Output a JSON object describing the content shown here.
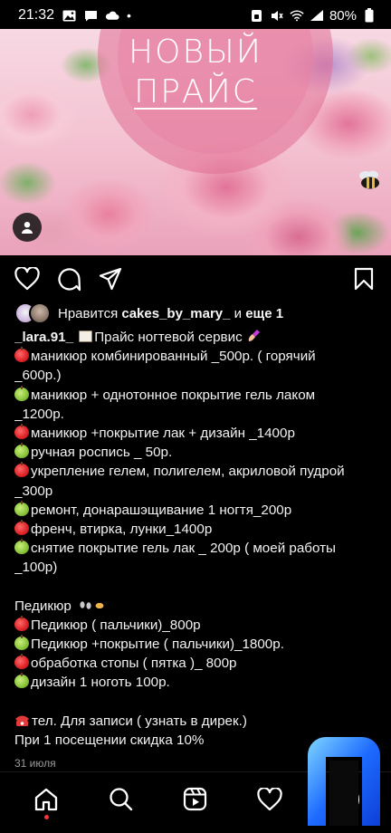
{
  "status_bar": {
    "time": "21:32",
    "battery": "80%",
    "dot": "•"
  },
  "post": {
    "image_title_line1": "НОВЫЙ",
    "image_title_line2": "ПРАЙС",
    "likes": {
      "prefix": "Нравится",
      "user": "cakes_by_mary_",
      "and": "и",
      "more": "еще 1"
    },
    "caption": {
      "username": "_lara.91_",
      "title": "Прайс ногтевой  сервис",
      "lines": [
        {
          "icon": "red-apple-icon",
          "text": "маникюр  комбинированный _500р. ( горячий"
        },
        {
          "icon": "",
          "text": "_600р.)"
        },
        {
          "icon": "green-apple-icon",
          "text": "маникюр + однотонное покрытие гель лаком"
        },
        {
          "icon": "",
          "text": "_1200р."
        },
        {
          "icon": "red-apple-icon",
          "text": "маникюр +покрытие лак + дизайн _1400р"
        },
        {
          "icon": "green-apple-icon",
          "text": "ручная  роспись _ 50р."
        },
        {
          "icon": "red-apple-icon",
          "text": "укрепление гелем,  полигелем, акриловой пудрой"
        },
        {
          "icon": "",
          "text": "_300р"
        },
        {
          "icon": "green-apple-icon",
          "text": "ремонт, донарашэщивание 1 ногтя_200р"
        },
        {
          "icon": "red-apple-icon",
          "text": "френч, втирка, лунки_1400р"
        },
        {
          "icon": "green-apple-icon",
          "text": "снятие покрытие гель лак _ 200р ( моей работы"
        },
        {
          "icon": "",
          "text": "_100р)"
        },
        {
          "icon": "",
          "text": ""
        },
        {
          "icon": "",
          "text": "Педикюр"
        },
        {
          "icon": "red-apple-icon",
          "text": "Педикюр ( пальчики)_800р"
        },
        {
          "icon": "green-apple-icon",
          "text": "Педикюр +покрытие ( пальчики)_1800р."
        },
        {
          "icon": "red-apple-icon",
          "text": "обработка стопы ( пятка )_ 800р"
        },
        {
          "icon": "green-apple-icon",
          "text": "дизайн 1 ноготь 100р."
        },
        {
          "icon": "",
          "text": ""
        },
        {
          "icon": "alarm-clock-icon",
          "text": "тел. Для записи ( узнать  в дирек.)"
        },
        {
          "icon": "",
          "text": "При 1 посещении скидка 10%"
        }
      ]
    },
    "date": "31 июля"
  },
  "icons": {
    "like": "heart-icon",
    "comment": "comment-icon",
    "share": "paper-plane-icon",
    "save": "bookmark-icon"
  },
  "colors": {
    "background": "#000000",
    "text": "#f5f5f5",
    "muted": "#9a9a9a",
    "notification_dot": "#ff3040",
    "badge_blue": "#1e6bff"
  }
}
